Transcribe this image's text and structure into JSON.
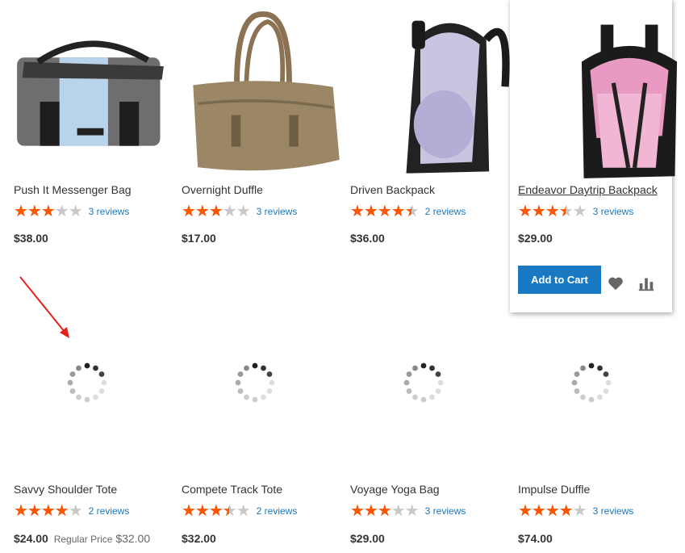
{
  "products_row1": [
    {
      "name": "Push It Messenger Bag",
      "reviews": "3 reviews",
      "price": "$38.00",
      "rating_pct": 60
    },
    {
      "name": "Overnight Duffle",
      "reviews": "3 reviews",
      "price": "$17.00",
      "rating_pct": 60
    },
    {
      "name": "Driven Backpack",
      "reviews": "2 reviews",
      "price": "$36.00",
      "rating_pct": 90
    },
    {
      "name": "Endeavor Daytrip Backpack",
      "reviews": "3 reviews",
      "price": "$29.00",
      "rating_pct": 70
    }
  ],
  "products_row2": [
    {
      "name": "Savvy Shoulder Tote",
      "reviews": "2 reviews",
      "price": "$24.00",
      "old_label": "Regular Price",
      "old_price": "$32.00",
      "rating_pct": 80
    },
    {
      "name": "Compete Track Tote",
      "reviews": "2 reviews",
      "price": "$32.00",
      "rating_pct": 70
    },
    {
      "name": "Voyage Yoga Bag",
      "reviews": "3 reviews",
      "price": "$29.00",
      "rating_pct": 60
    },
    {
      "name": "Impulse Duffle",
      "reviews": "3 reviews",
      "price": "$74.00",
      "rating_pct": 80
    }
  ],
  "actions": {
    "add_to_cart": "Add to Cart",
    "wishlist_icon": "heart-icon",
    "compare_icon": "bar-chart-icon"
  },
  "colors": {
    "accent": "#1979c3",
    "star": "#ff5501",
    "annotation_arrow": "#e8201c"
  },
  "stars_glyph": "★★★★★"
}
